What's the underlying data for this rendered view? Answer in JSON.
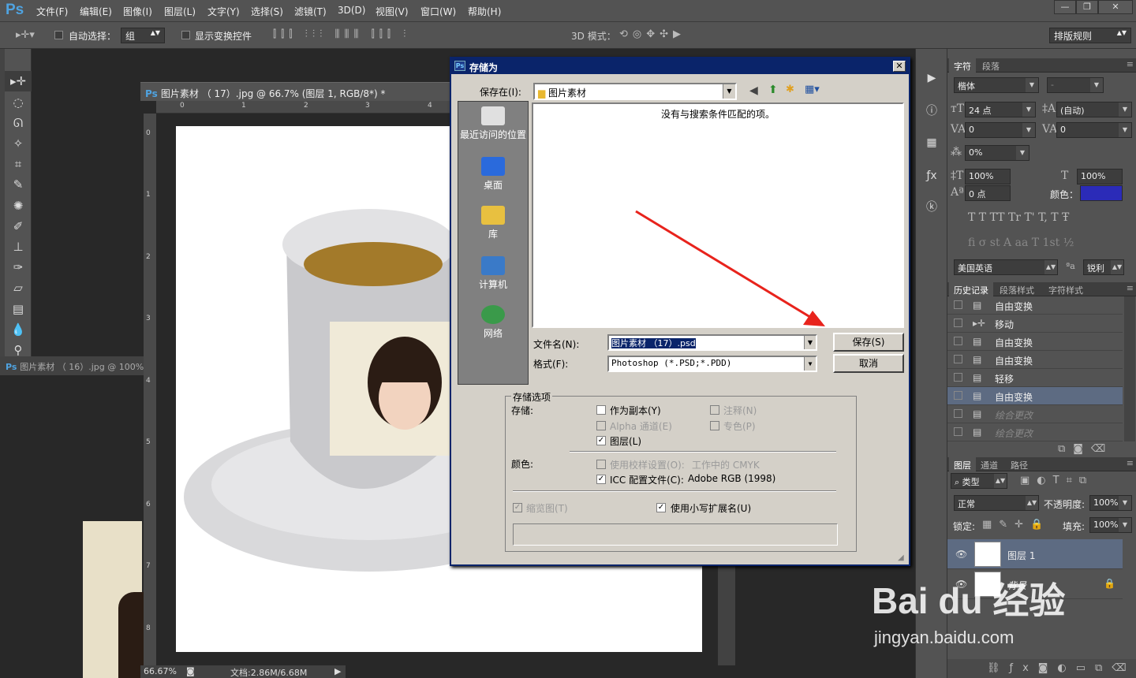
{
  "app": {
    "logo": "Ps",
    "menu": [
      "文件(F)",
      "编辑(E)",
      "图像(I)",
      "图层(L)",
      "文字(Y)",
      "选择(S)",
      "滤镜(T)",
      "3D(D)",
      "视图(V)",
      "窗口(W)",
      "帮助(H)"
    ]
  },
  "options": {
    "auto_select_label": "自动选择：",
    "auto_select_value": "组",
    "show_transform_label": "显示变换控件",
    "mode_3d_label": "3D 模式：",
    "workspace": "排版规则"
  },
  "documents": {
    "main_title": "图片素材 （ 17）.jpg @ 66.7% (图层 1, RGB/8*) *",
    "second_title": "图片素材 （ 16）.jpg @ 100%",
    "ruler_h": [
      "0",
      "1",
      "2",
      "3",
      "4"
    ],
    "ruler_v": [
      "0",
      "1",
      "2",
      "3",
      "4",
      "5",
      "6",
      "7",
      "8"
    ],
    "zoom": "66.67%",
    "doc_size": "文档:2.86M/6.68M"
  },
  "dialog": {
    "title": "存储为",
    "save_in_label": "保存在(I):",
    "save_in_value": "图片素材",
    "empty_message": "没有与搜索条件匹配的项。",
    "places": [
      "最近访问的位置",
      "桌面",
      "库",
      "计算机",
      "网络"
    ],
    "filename_label": "文件名(N):",
    "filename_value": "图片素材 （17）.psd",
    "format_label": "格式(F):",
    "format_value": "Photoshop (*.PSD;*.PDD)",
    "save_button": "保存(S)",
    "cancel_button": "取消",
    "group_title": "存储选项",
    "save_label": "存储:",
    "opt_copy": "作为副本(Y)",
    "opt_notes": "注释(N)",
    "opt_alpha": "Alpha 通道(E)",
    "opt_spot": "专色(P)",
    "opt_layers": "图层(L)",
    "color_label": "颜色:",
    "opt_proof": "使用校样设置(O):",
    "opt_proof_value": "工作中的 CMYK",
    "opt_icc": "ICC 配置文件(C):",
    "opt_icc_value": "Adobe RGB (1998)",
    "opt_thumb": "缩览图(T)",
    "opt_lowercase": "使用小写扩展名(U)"
  },
  "char_panel": {
    "tabs": [
      "字符",
      "段落"
    ],
    "font": "楷体",
    "style": "-",
    "size": "24 点",
    "leading": "(自动)",
    "kerning": "0",
    "tracking": "0",
    "scale_pct": "0%",
    "v_scale": "100%",
    "h_scale": "100%",
    "baseline": "0 点",
    "color_label": "颜色：",
    "color": "#2b2bb8",
    "glyph_row1": "T  T  TT  Tr  T'  T,  T  Ŧ",
    "glyph_row2": "fi  σ  st  A  aa  T  1st  ½",
    "language": "美国英语",
    "aa_label": "ªa",
    "aa_value": "锐利"
  },
  "history_panel": {
    "tabs": [
      "历史记录",
      "段落样式",
      "字符样式"
    ],
    "items": [
      "自由变换",
      "移动",
      "自由变换",
      "自由变换",
      "轻移",
      "自由变换",
      "绘合更改",
      "绘合更改"
    ]
  },
  "layers_panel": {
    "tabs": [
      "图层",
      "通道",
      "路径"
    ],
    "filter": "类型",
    "blend": "正常",
    "opacity_label": "不透明度:",
    "opacity": "100%",
    "lock_label": "锁定:",
    "fill_label": "填充:",
    "fill": "100%",
    "layers": [
      "图层 1",
      "背景"
    ]
  },
  "watermark": {
    "brand": "Bai du 经验",
    "url": "jingyan.baidu.com"
  }
}
